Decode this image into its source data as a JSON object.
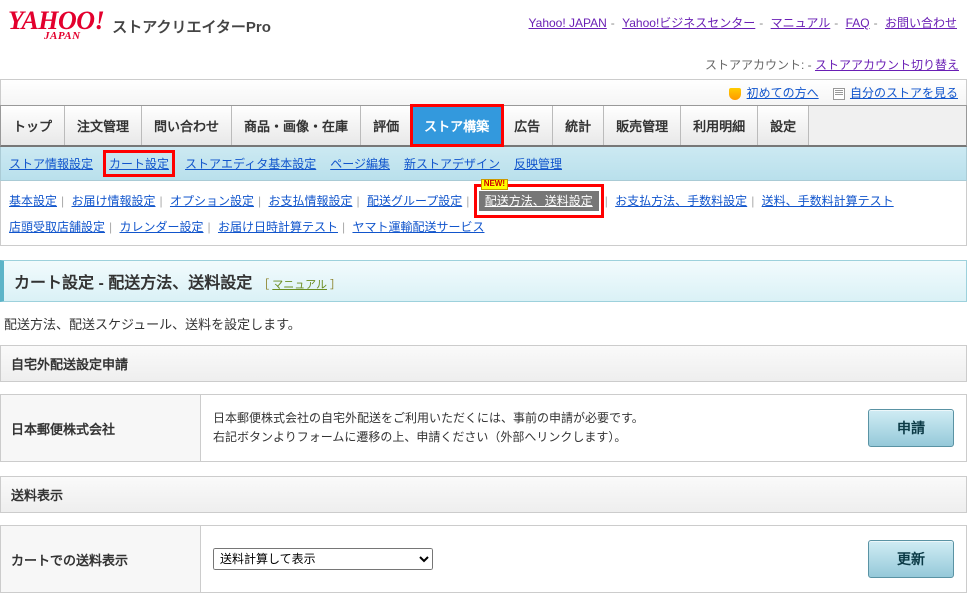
{
  "header": {
    "logo_main": "YAHOO!",
    "logo_sub": "JAPAN",
    "product": "ストアクリエイターPro",
    "links": [
      "Yahoo! JAPAN",
      "Yahoo!ビジネスセンター",
      "マニュアル",
      "FAQ",
      "お問い合わせ"
    ]
  },
  "account": {
    "label": "ストアアカウント:",
    "switch_link": "ストアアカウント切り替え"
  },
  "info_bar": {
    "beginner": "初めての方へ",
    "my_store": "自分のストアを見る"
  },
  "main_tabs": [
    "トップ",
    "注文管理",
    "問い合わせ",
    "商品・画像・在庫",
    "評価",
    "ストア構築",
    "広告",
    "統計",
    "販売管理",
    "利用明細",
    "設定"
  ],
  "sub_nav1": [
    "ストア情報設定",
    "カート設定",
    "ストアエディタ基本設定",
    "ページ編集",
    "新ストアデザイン",
    "反映管理"
  ],
  "sub_nav2_row1": [
    "基本設定",
    "お届け情報設定",
    "オプション設定",
    "お支払情報設定",
    "配送グループ設定",
    "配送方法、送料設定",
    "お支払方法、手数料設定",
    "送料、手数料計算テスト"
  ],
  "sub_nav2_row2": [
    "店頭受取店舗設定",
    "カレンダー設定",
    "お届け日時計算テスト",
    "ヤマト運輸配送サービス"
  ],
  "new_badge": "NEW!",
  "page_title": {
    "main": "カート設定 - 配送方法、送料設定",
    "manual_label": "マニュアル"
  },
  "description": "配送方法、配送スケジュール、送料を設定します。",
  "section1": {
    "heading": "自宅外配送設定申請",
    "row_label": "日本郵便株式会社",
    "body_line1": "日本郵便株式会社の自宅外配送をご利用いただくには、事前の申請が必要です。",
    "body_line2": "右記ボタンよりフォームに遷移の上、申請ください（外部へリンクします）。",
    "button": "申請"
  },
  "section2": {
    "heading": "送料表示",
    "row_label": "カートでの送料表示",
    "select_value": "送料計算して表示",
    "button": "更新"
  }
}
